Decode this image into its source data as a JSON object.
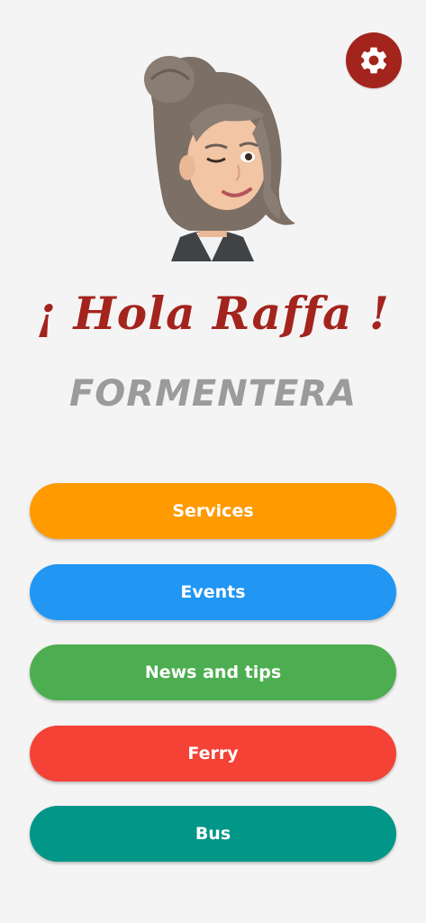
{
  "header": {
    "settings_icon": "gear-icon",
    "greeting": "¡ Hola Raffa !",
    "location": "FORMENTERA"
  },
  "menu": {
    "services": "Services",
    "events": "Events",
    "news": "News and tips",
    "ferry": "Ferry",
    "bus": "Bus"
  },
  "colors": {
    "brand_red": "#a3241d",
    "location_gray": "#9b9b9b",
    "services": "#ff9a00",
    "events": "#2196f3",
    "news": "#4cae50",
    "ferry": "#f44236",
    "bus": "#009688"
  }
}
